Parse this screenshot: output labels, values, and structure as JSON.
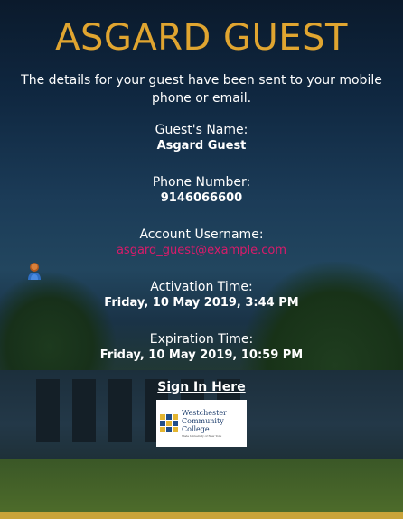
{
  "header": {
    "title": "ASGARD GUEST"
  },
  "intro_text": "The details for your guest have been sent to your mobile phone or email.",
  "guest": {
    "name_label": "Guest's Name:",
    "name_value": "Asgard Guest",
    "phone_label": "Phone Number:",
    "phone_value": "9146066600",
    "username_label": "Account Username:",
    "username_value": "asgard_guest@example.com",
    "activation_label": "Activation Time:",
    "activation_value": "Friday, 10 May 2019, 3:44 PM",
    "expiration_label": "Expiration Time:",
    "expiration_value": "Friday, 10 May 2019, 10:59 PM"
  },
  "signin": {
    "label": "Sign In Here"
  },
  "logo": {
    "line1": "Westchester",
    "line2": "Community College",
    "line3": "State University of New York"
  },
  "colors": {
    "title": "#e0a530",
    "email": "#d81b6a",
    "accent_gold": "#c9a43a"
  },
  "icons": {
    "avatar": "user-avatar-icon"
  }
}
